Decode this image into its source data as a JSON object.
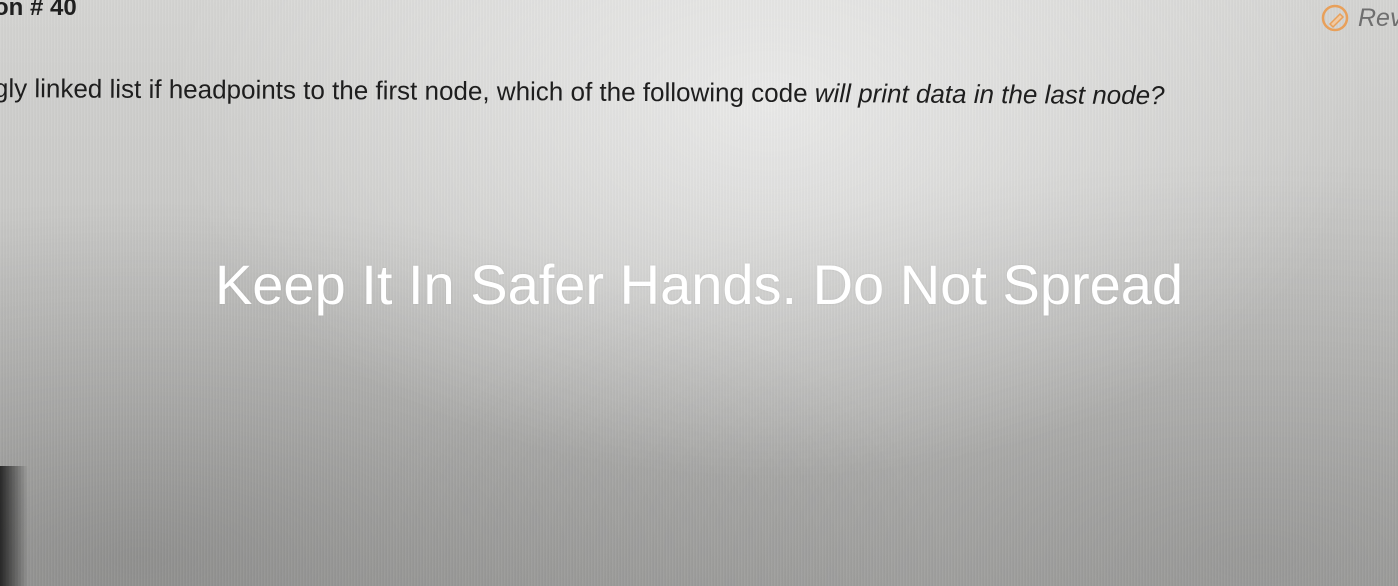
{
  "question": {
    "number_label": "on # 40",
    "text_part1": "gly linked list if headpoints to the first node, which of the following code ",
    "text_part2": "will print data in the last node?"
  },
  "review": {
    "label": "Revi",
    "icon": "review-edit-icon",
    "icon_color": "#e8a05a"
  },
  "watermark": {
    "text": "Keep It In Safer Hands. Do Not Spread"
  }
}
